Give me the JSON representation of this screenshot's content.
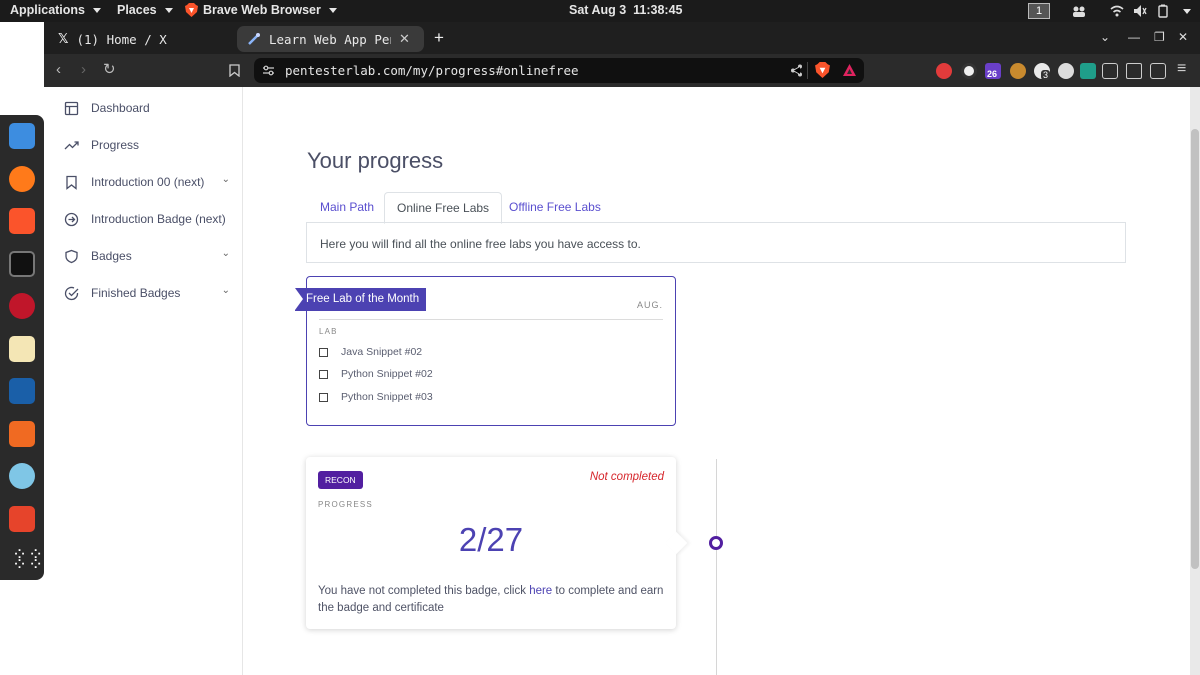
{
  "desktop": {
    "applications_label": "Applications",
    "places_label": "Places",
    "active_app_label": "Brave Web Browser",
    "clock": "Sat Aug 3  11:38:45",
    "workspace": "1"
  },
  "browser": {
    "tabs": [
      {
        "title": "(1) Home / X",
        "icon": "x-logo-icon"
      },
      {
        "title": "Learn Web App Pente",
        "icon": "pentesterlab-icon"
      }
    ],
    "url": "pentesterlab.com/my/progress#onlinefree",
    "extensions": [
      {
        "icon": "ext-ublock-icon"
      },
      {
        "icon": "ext-badge-icon",
        "badge": "26"
      },
      {
        "icon": "ext-cookie-icon"
      },
      {
        "icon": "ext-badge2-icon",
        "badge": "3"
      }
    ]
  },
  "sidebar": {
    "items": [
      {
        "label": "Dashboard",
        "icon": "dashboard-icon"
      },
      {
        "label": "Progress",
        "icon": "trending-icon"
      },
      {
        "label": "Introduction 00 (next)",
        "icon": "bookmark-icon",
        "expandable": true
      },
      {
        "label": "Introduction Badge (next)",
        "icon": "arrow-circle-icon"
      },
      {
        "label": "Badges",
        "icon": "shield-icon",
        "expandable": true
      },
      {
        "label": "Finished Badges",
        "icon": "check-circle-icon",
        "expandable": true
      }
    ]
  },
  "main": {
    "title": "Your progress",
    "tabs": [
      {
        "label": "Main Path"
      },
      {
        "label": "Online Free Labs"
      },
      {
        "label": "Offline Free Labs"
      }
    ],
    "active_tab": "Online Free Labs",
    "tab_description": "Here you will find all the online free labs you have access to.",
    "free_lab": {
      "ribbon": "Free Lab of the Month",
      "month": "AUG.",
      "section_label": "LAB",
      "labs": [
        "Java Snippet #02",
        "Python Snippet #02",
        "Python Snippet #03"
      ]
    },
    "badge_card": {
      "tag": "RECON",
      "status": "Not completed",
      "progress_label": "PROGRESS",
      "progress": "2/27",
      "text_before": "You have not completed this badge, click ",
      "link": "here",
      "text_after": " to complete and earn the badge and certificate"
    }
  },
  "colors": {
    "accent": "#4c42b2",
    "recon": "#521fa0",
    "status_red": "#d6262c",
    "sidebar_text": "#4a4f67"
  }
}
